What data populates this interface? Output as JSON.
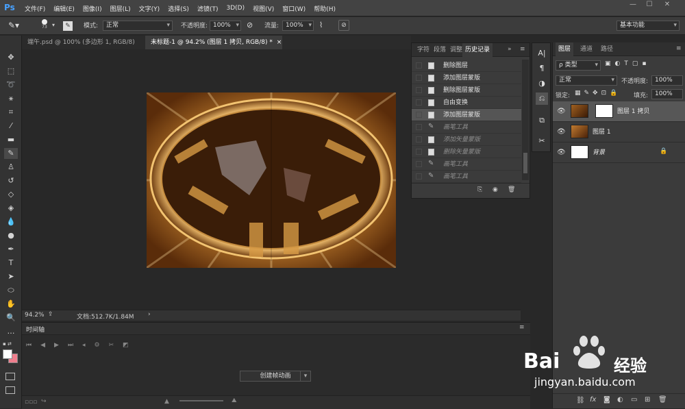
{
  "app": {
    "logo": "Ps"
  },
  "menu": [
    "文件(F)",
    "编辑(E)",
    "图像(I)",
    "图层(L)",
    "文字(Y)",
    "选择(S)",
    "滤镜(T)",
    "3D(D)",
    "视图(V)",
    "窗口(W)",
    "帮助(H)"
  ],
  "window_controls": [
    "—",
    "☐",
    "✕"
  ],
  "options": {
    "brush_size": "73",
    "mode_label": "模式:",
    "mode_value": "正常",
    "opacity_label": "不透明度:",
    "opacity_value": "100%",
    "flow_label": "流量:",
    "flow_value": "100%",
    "workspace": "基本功能"
  },
  "tabs": [
    {
      "label": "端午.psd @ 100% (多边形 1, RGB/8)",
      "close": "×"
    },
    {
      "label": "未标题-1 @ 94.2% (图层 1 拷贝, RGB/8) *",
      "close": "×"
    }
  ],
  "status": {
    "zoom": "94.2%",
    "doc": "文档:512.7K/1.84M",
    "arrow": "›"
  },
  "history_panel": {
    "tabs": [
      "字符",
      "段落",
      "调整",
      "历史记录"
    ],
    "items": [
      {
        "label": "删除图层",
        "type": "doc",
        "dim": false
      },
      {
        "label": "添加图层蒙版",
        "type": "doc",
        "dim": false
      },
      {
        "label": "删除图层蒙版",
        "type": "doc",
        "dim": false
      },
      {
        "label": "自由变换",
        "type": "doc",
        "dim": false
      },
      {
        "label": "添加图层蒙版",
        "type": "doc",
        "dim": false,
        "selected": true
      },
      {
        "label": "画笔工具",
        "type": "brush",
        "dim": true
      },
      {
        "label": "添加矢量蒙版",
        "type": "doc",
        "dim": true
      },
      {
        "label": "删除矢量蒙版",
        "type": "doc",
        "dim": true
      },
      {
        "label": "画笔工具",
        "type": "brush",
        "dim": true
      },
      {
        "label": "画笔工具",
        "type": "brush",
        "dim": true
      }
    ]
  },
  "layers_panel": {
    "tabs": [
      "图层",
      "通道",
      "路径"
    ],
    "filter": "ρ 类型",
    "blend": "正常",
    "opacity_label": "不透明度:",
    "opacity_value": "100%",
    "lock_label": "锁定:",
    "fill_label": "填充:",
    "fill_value": "100%",
    "layers": [
      {
        "name": "图层 1 拷贝",
        "italic": false,
        "has_mask": true,
        "selected": true
      },
      {
        "name": "图层 1",
        "italic": false,
        "has_mask": false,
        "selected": false
      },
      {
        "name": "背景",
        "italic": true,
        "has_mask": false,
        "selected": false,
        "locked": true
      }
    ],
    "bottom_icons": [
      "link",
      "fx",
      "mask",
      "adjust",
      "folder",
      "new",
      "trash"
    ]
  },
  "timeline": {
    "title": "时间轴",
    "create_button": "创建帧动画"
  },
  "watermark": {
    "brand": "Bai",
    "brand2": "经验",
    "url": "jingyan.baidu.com"
  }
}
